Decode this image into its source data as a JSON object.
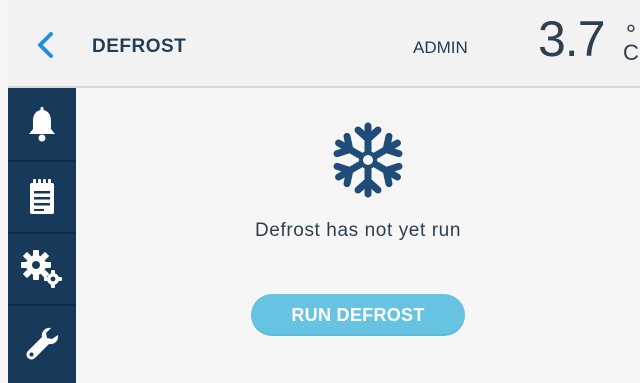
{
  "header": {
    "back_icon": "chevron-left-icon",
    "title": "DEFROST",
    "user": "ADMIN",
    "temperature": "3.7",
    "unit_degree": "°",
    "unit_letter": "C"
  },
  "sidebar": {
    "items": [
      {
        "icon": "bell-icon",
        "label": "alarms"
      },
      {
        "icon": "notepad-icon",
        "label": "log"
      },
      {
        "icon": "gears-icon",
        "label": "settings"
      },
      {
        "icon": "wrench-icon",
        "label": "service"
      }
    ]
  },
  "main": {
    "status_icon": "snowflake-icon",
    "message": "Defrost has not yet run",
    "run_button_label": "RUN DEFROST"
  },
  "colors": {
    "accent": "#1e90e0",
    "sidebar": "#17395a",
    "button": "#66c3e2",
    "snowflake": "#1f4c79"
  }
}
